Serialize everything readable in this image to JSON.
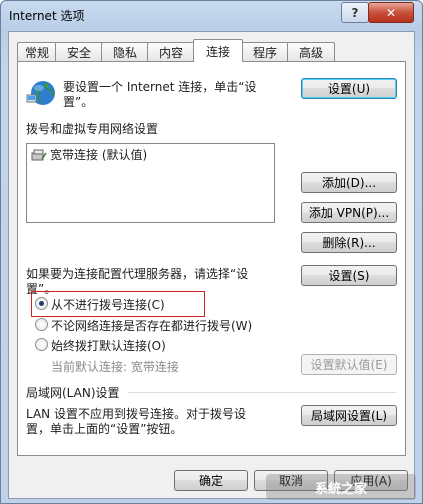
{
  "window": {
    "title": "Internet 选项",
    "help": "?",
    "close": "✕"
  },
  "tabs": [
    "常规",
    "安全",
    "隐私",
    "内容",
    "连接",
    "程序",
    "高级"
  ],
  "active_tab": "连接",
  "setup": {
    "text_line1": "要设置一个 Internet 连接，单击“设",
    "text_line2": "置”。",
    "button": "设置(U)"
  },
  "dialup": {
    "heading": "拨号和虚拟专用网络设置",
    "items": [
      {
        "label": "宽带连接 (默认值)"
      }
    ],
    "add_button": "添加(D)...",
    "add_vpn_button": "添加 VPN(P)...",
    "delete_button": "删除(R)...",
    "proxy_text_line1": "如果要为连接配置代理服务器，请选择“设",
    "proxy_text_line2": "置”。",
    "settings_button": "设置(S)"
  },
  "radios": [
    {
      "label": "从不进行拨号连接(C)",
      "checked": true
    },
    {
      "label": "不论网络连接是否存在都进行拨号(W)",
      "checked": false
    },
    {
      "label": "始终拨打默认连接(O)",
      "checked": false
    }
  ],
  "current_default": "当前默认连接: 宽带连接",
  "set_default_button": "设置默认值(E)",
  "lan": {
    "heading": "局域网(LAN)设置",
    "text_line1": "LAN 设置不应用到拨号连接。对于拨号设",
    "text_line2": "置，单击上面的“设置”按钮。",
    "button": "局域网设置(L)"
  },
  "footer": {
    "ok": "确定",
    "cancel": "取消",
    "apply": "应用(A)"
  },
  "watermark": "系统之家"
}
